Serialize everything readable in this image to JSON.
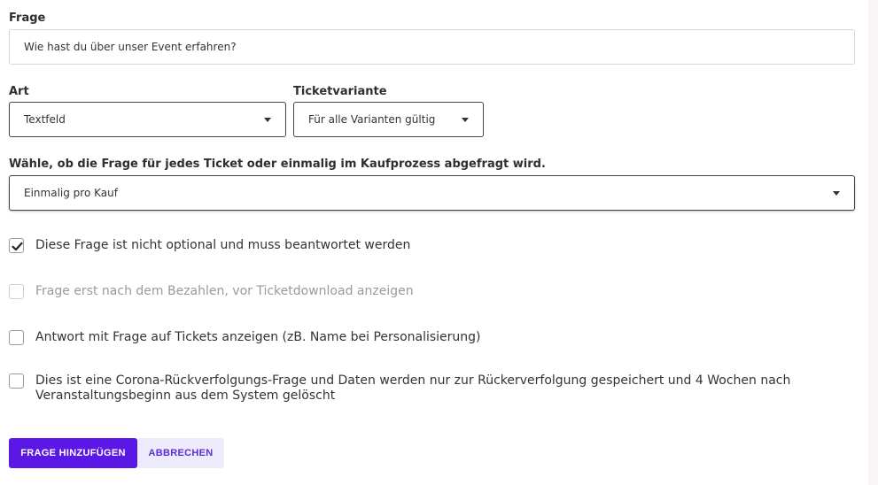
{
  "question": {
    "label": "Frage",
    "value": "Wie hast du über unser Event erfahren?"
  },
  "type": {
    "label": "Art",
    "selected": "Textfeld"
  },
  "ticket_variant": {
    "label": "Ticketvariante",
    "selected": "Für alle Varianten gültig"
  },
  "frequency": {
    "label": "Wähle, ob die Frage für jedes Ticket oder einmalig im Kaufprozess abgefragt wird.",
    "selected": "Einmalig pro Kauf"
  },
  "options": [
    {
      "label": "Diese Frage ist nicht optional und muss beantwortet werden",
      "checked": true,
      "disabled": false
    },
    {
      "label": "Frage erst nach dem Bezahlen, vor Ticketdownload anzeigen",
      "checked": false,
      "disabled": true
    },
    {
      "label": "Antwort mit Frage auf Tickets anzeigen (zB. Name bei Personalisierung)",
      "checked": false,
      "disabled": false
    },
    {
      "label": "Dies ist eine Corona-Rückverfolgungs-Frage und Daten werden nur zur Rückerverfolgung gespeichert und 4 Wochen nach Veranstaltungsbeginn aus dem System gelöscht",
      "checked": false,
      "disabled": false
    }
  ],
  "actions": {
    "add_label": "FRAGE HINZUFÜGEN",
    "cancel_label": "ABBRECHEN"
  },
  "colors": {
    "primary": "#5b17e6",
    "secondary_bg": "#eeebfd",
    "secondary_text": "#5b2fd6"
  }
}
